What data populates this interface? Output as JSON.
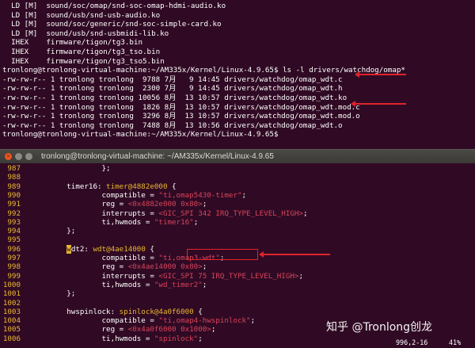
{
  "upper_terminal": {
    "lines": [
      "  LD [M]  sound/soc/omap/snd-soc-omap-hdmi-audio.ko",
      "  LD [M]  sound/usb/snd-usb-audio.ko",
      "  LD [M]  sound/soc/generic/snd-soc-simple-card.ko",
      "  LD [M]  sound/usb/snd-usbmidi-lib.ko",
      "  IHEX    firmware/tigon/tg3.bin",
      "  IHEX    firmware/tigon/tg3_tso.bin",
      "  IHEX    firmware/tigon/tg3_tso5.bin",
      "tronlong@tronlong-virtual-machine:~/AM335x/Kernel/Linux-4.9.65$ ls -l drivers/watchdog/omap*",
      "-rw-rw-r-- 1 tronlong tronlong  9788 7月   9 14:45 drivers/watchdog/omap_wdt.c",
      "-rw-rw-r-- 1 tronlong tronlong  2300 7月   9 14:45 drivers/watchdog/omap_wdt.h",
      "-rw-rw-r-- 1 tronlong tronlong 10056 8月  13 10:57 drivers/watchdog/omap_wdt.ko",
      "-rw-rw-r-- 1 tronlong tronlong  1826 8月  13 10:57 drivers/watchdog/omap_wdt.mod.c",
      "-rw-rw-r-- 1 tronlong tronlong  3296 8月  13 10:57 drivers/watchdog/omap_wdt.mod.o",
      "-rw-rw-r-- 1 tronlong tronlong  7488 8月  13 10:56 drivers/watchdog/omap_wdt.o",
      "tronlong@tronlong-virtual-machine:~/AM335x/Kernel/Linux-4.9.65$"
    ]
  },
  "window": {
    "title": "tronlong@tronlong-virtual-machine: ~/AM335x/Kernel/Linux-4.9.65",
    "close_glyph": "×"
  },
  "editor": {
    "lines": [
      {
        "n": "987",
        "segs": [
          {
            "t": "                };",
            "c": "plain"
          }
        ]
      },
      {
        "n": "988",
        "segs": [
          {
            "t": "",
            "c": "plain"
          }
        ]
      },
      {
        "n": "989",
        "segs": [
          {
            "t": "        timer16: ",
            "c": "plain"
          },
          {
            "t": "timer@4882e000",
            "c": "node"
          },
          {
            "t": " {",
            "c": "plain"
          }
        ]
      },
      {
        "n": "990",
        "segs": [
          {
            "t": "                compatible = ",
            "c": "plain"
          },
          {
            "t": "\"ti,omap5430-timer\"",
            "c": "str"
          },
          {
            "t": ";",
            "c": "plain"
          }
        ]
      },
      {
        "n": "991",
        "segs": [
          {
            "t": "                reg = ",
            "c": "plain"
          },
          {
            "t": "<0x4882e000 0x80>",
            "c": "str"
          },
          {
            "t": ";",
            "c": "plain"
          }
        ]
      },
      {
        "n": "992",
        "segs": [
          {
            "t": "                interrupts = ",
            "c": "plain"
          },
          {
            "t": "<GIC_SPI 342 IRQ_TYPE_LEVEL_HIGH>",
            "c": "str"
          },
          {
            "t": ";",
            "c": "plain"
          }
        ]
      },
      {
        "n": "993",
        "segs": [
          {
            "t": "                ti,hwmods = ",
            "c": "plain"
          },
          {
            "t": "\"timer16\"",
            "c": "str"
          },
          {
            "t": ";",
            "c": "plain"
          }
        ]
      },
      {
        "n": "994",
        "segs": [
          {
            "t": "        };",
            "c": "plain"
          }
        ]
      },
      {
        "n": "995",
        "segs": [
          {
            "t": "",
            "c": "plain"
          }
        ]
      },
      {
        "n": "996",
        "segs": [
          {
            "t": "        ",
            "c": "plain"
          },
          {
            "t": "w",
            "c": "hl"
          },
          {
            "t": "dt2: ",
            "c": "plain"
          },
          {
            "t": "wdt@4ae14000",
            "c": "node"
          },
          {
            "t": " {",
            "c": "plain"
          }
        ]
      },
      {
        "n": "997",
        "segs": [
          {
            "t": "                compatible = ",
            "c": "plain"
          },
          {
            "t": "\"ti,omap3-wdt\"",
            "c": "str"
          },
          {
            "t": ";",
            "c": "plain"
          }
        ]
      },
      {
        "n": "998",
        "segs": [
          {
            "t": "                reg = ",
            "c": "plain"
          },
          {
            "t": "<0x4ae14000 0x80>",
            "c": "str"
          },
          {
            "t": ";",
            "c": "plain"
          }
        ]
      },
      {
        "n": "999",
        "segs": [
          {
            "t": "                interrupts = ",
            "c": "plain"
          },
          {
            "t": "<GIC_SPI 75 IRQ_TYPE_LEVEL_HIGH>",
            "c": "str"
          },
          {
            "t": ";",
            "c": "plain"
          }
        ]
      },
      {
        "n": "1000",
        "segs": [
          {
            "t": "                ti,hwmods = ",
            "c": "plain"
          },
          {
            "t": "\"wd_timer2\"",
            "c": "str"
          },
          {
            "t": ";",
            "c": "plain"
          }
        ]
      },
      {
        "n": "1001",
        "segs": [
          {
            "t": "        };",
            "c": "plain"
          }
        ]
      },
      {
        "n": "1002",
        "segs": [
          {
            "t": "",
            "c": "plain"
          }
        ]
      },
      {
        "n": "1003",
        "segs": [
          {
            "t": "        hwspinlock: ",
            "c": "plain"
          },
          {
            "t": "spinlock@4a0f6000",
            "c": "node"
          },
          {
            "t": " {",
            "c": "plain"
          }
        ]
      },
      {
        "n": "1004",
        "segs": [
          {
            "t": "                compatible = ",
            "c": "plain"
          },
          {
            "t": "\"ti,omap4-hwspinlock\"",
            "c": "str"
          },
          {
            "t": ";",
            "c": "plain"
          }
        ]
      },
      {
        "n": "1005",
        "segs": [
          {
            "t": "                reg = ",
            "c": "plain"
          },
          {
            "t": "<0x4a0f6000 0x1000>",
            "c": "str"
          },
          {
            "t": ";",
            "c": "plain"
          }
        ]
      },
      {
        "n": "1006",
        "segs": [
          {
            "t": "                ti,hwmods = ",
            "c": "plain"
          },
          {
            "t": "\"spinlock\"",
            "c": "str"
          },
          {
            "t": ";",
            "c": "plain"
          }
        ]
      }
    ],
    "status_position": "996,2-16",
    "status_percent": "41%"
  },
  "watermark": "知乎 @Tronlong创龙",
  "colors": {
    "background": "#300a24",
    "line_number": "#e8b72e",
    "string": "#d9435b",
    "annotation": "#e0232b"
  }
}
